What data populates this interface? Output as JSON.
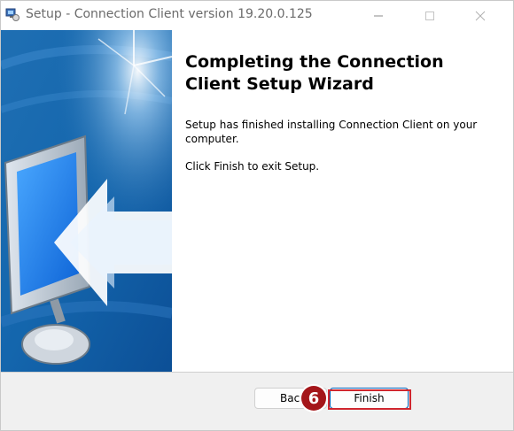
{
  "window": {
    "title": "Setup - Connection Client version 19.20.0.125"
  },
  "titlebar": {
    "minimize_icon": "minimize-icon",
    "maximize_icon": "maximize-icon",
    "close_icon": "close-icon"
  },
  "content": {
    "heading": "Completing the Connection Client Setup Wizard",
    "paragraph1": "Setup has finished installing Connection Client on your computer.",
    "paragraph2": "Click Finish to exit Setup."
  },
  "footer": {
    "back_label": "Back",
    "finish_label": "Finish",
    "step_badge": "6"
  },
  "colors": {
    "accent": "#005fb8",
    "highlight": "#d0262e",
    "badge": "#a4161a"
  }
}
